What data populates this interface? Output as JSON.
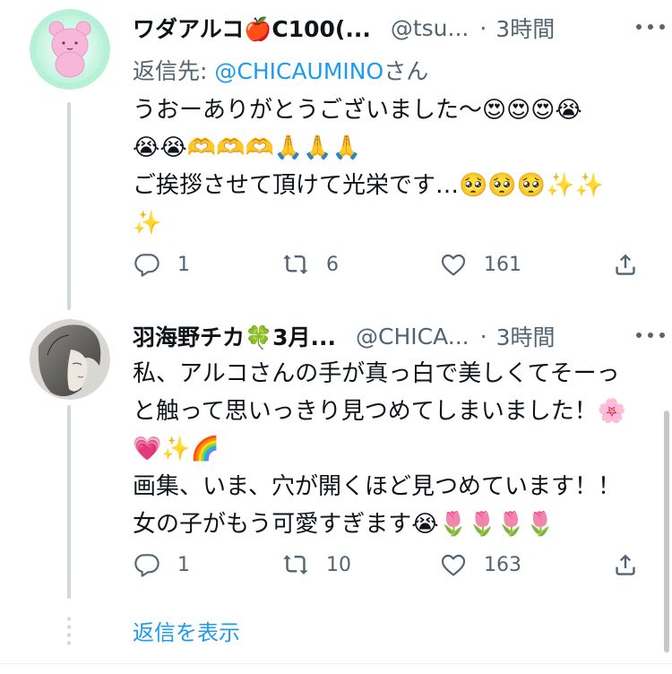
{
  "tweets": [
    {
      "name": "ワダアルコ🍎C100(...",
      "handle": "@tsu...",
      "sep": "·",
      "time": "3時間",
      "reply_prefix": "返信先: ",
      "reply_handle": "@CHICAUMINO",
      "reply_suffix": "さん",
      "lines": [
        "うおーありがとうございました〜😍😍😍😭",
        "😭😭🫶🫶🫶🙏🙏🙏",
        "ご挨拶させて頂けて光栄です…🥺🥺🥺✨✨",
        "✨"
      ],
      "replies": "1",
      "retweets": "6",
      "likes": "161"
    },
    {
      "name": "羽海野チカ🍀3月...",
      "handle": "@CHICA...",
      "sep": "·",
      "time": "3時間",
      "lines": [
        "私、アルコさんの手が真っ白で美しくてそーっ",
        "と触って思いっきり見つめてしまいました！🌸",
        "💗✨🌈",
        "画集、いま、穴が開くほど見つめています！！",
        "女の子がもう可愛すぎます😭🌷🌷🌷🌷"
      ],
      "replies": "1",
      "retweets": "10",
      "likes": "163"
    }
  ],
  "show_replies": "返信を表示",
  "icons": {
    "reply": "reply-icon",
    "retweet": "retweet-icon",
    "like": "heart-icon",
    "share": "share-icon",
    "more": "more-icon"
  },
  "colors": {
    "link": "#1d9bf0",
    "secondary": "#536471",
    "text": "#0f1419",
    "thread_line": "#cfd9de"
  }
}
